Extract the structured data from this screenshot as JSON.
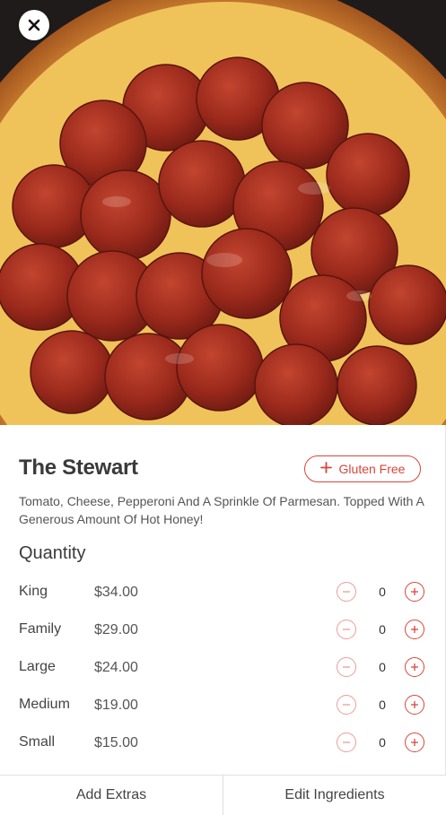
{
  "product": {
    "name": "The Stewart",
    "description": "Tomato, Cheese, Pepperoni And A Sprinkle Of Parmesan. Topped With A Generous Amount Of Hot Honey!",
    "badge_label": "Gluten Free"
  },
  "quantity": {
    "heading": "Quantity",
    "sizes": [
      {
        "name": "King",
        "price": "$34.00",
        "count": "0"
      },
      {
        "name": "Family",
        "price": "$29.00",
        "count": "0"
      },
      {
        "name": "Large",
        "price": "$24.00",
        "count": "0"
      },
      {
        "name": "Medium",
        "price": "$19.00",
        "count": "0"
      },
      {
        "name": "Small",
        "price": "$15.00",
        "count": "0"
      }
    ]
  },
  "footer": {
    "add_extras": "Add Extras",
    "edit_ingredients": "Edit Ingredients"
  },
  "colors": {
    "accent": "#d9453a",
    "accent_light": "#ec9c95"
  },
  "icons": {
    "close": "close-icon",
    "add": "plus-icon",
    "minus": "minus-icon"
  }
}
